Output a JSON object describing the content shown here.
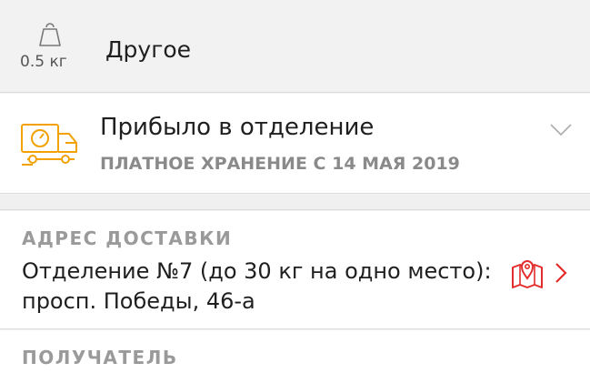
{
  "parcel": {
    "weight": "0.5 кг",
    "type": "Другое"
  },
  "status": {
    "title": "Прибыло в отделение",
    "subtitle": "ПЛАТНОЕ ХРАНЕНИЕ С 14 МАЯ 2019"
  },
  "delivery": {
    "label": "АДРЕС ДОСТАВКИ",
    "address": "Отделение №7 (до 30 кг на одно место): просп. Победы, 46-а"
  },
  "recipient": {
    "label": "ПОЛУЧАТЕЛЬ"
  },
  "colors": {
    "accent_orange": "#f2a100",
    "accent_red": "#e32d2d"
  },
  "icons": [
    "weight-icon",
    "truck-icon",
    "chevron-down-icon",
    "map-icon",
    "chevron-right-icon"
  ]
}
